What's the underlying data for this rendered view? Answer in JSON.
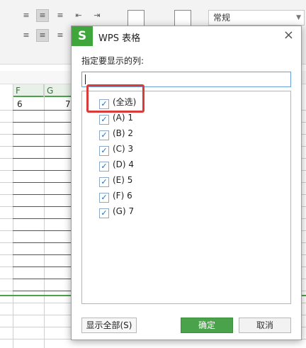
{
  "ribbon": {
    "number_format": "常规"
  },
  "sheet": {
    "columns": [
      "F",
      "G"
    ],
    "cells": [
      "6",
      "7"
    ]
  },
  "dialog": {
    "logo": "S",
    "title": "WPS 表格",
    "close": "×",
    "prompt": "指定要显示的列:",
    "search": {
      "value": "",
      "placeholder": ""
    },
    "items": [
      {
        "label": "(全选)",
        "checked": true
      },
      {
        "label": "(A) 1",
        "checked": true
      },
      {
        "label": "(B) 2",
        "checked": true
      },
      {
        "label": "(C) 3",
        "checked": true
      },
      {
        "label": "(D) 4",
        "checked": true
      },
      {
        "label": "(E) 5",
        "checked": true
      },
      {
        "label": "(F) 6",
        "checked": true
      },
      {
        "label": "(G) 7",
        "checked": true
      }
    ],
    "show_all_label": "显示全部(S)",
    "ok_label": "确定",
    "cancel_label": "取消"
  },
  "colors": {
    "accent_green": "#3fa63c",
    "highlight_red": "#d93a3a"
  }
}
